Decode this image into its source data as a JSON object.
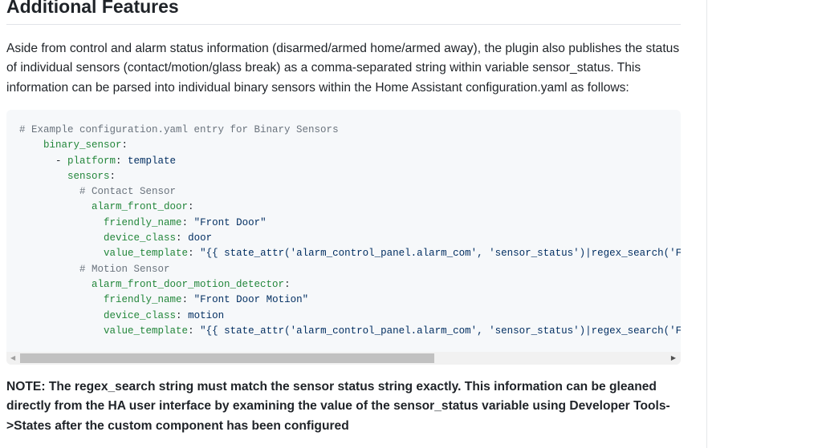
{
  "heading": "Additional Features",
  "intro": "Aside from control and alarm status information (disarmed/armed home/armed away), the plugin also publishes the status of individual sensors (contact/motion/glass break) as a comma-separated string within variable sensor_status. This information can be parsed into individual binary sensors within the Home Assistant configuration.yaml as follows:",
  "code_lines": [
    [
      {
        "t": "# Example configuration.yaml entry for Binary Sensors",
        "c": "c"
      }
    ],
    [
      {
        "t": "    ",
        "c": "p"
      },
      {
        "t": "binary_sensor",
        "c": "k"
      },
      {
        "t": ":",
        "c": "p"
      }
    ],
    [
      {
        "t": "      - ",
        "c": "p"
      },
      {
        "t": "platform",
        "c": "k"
      },
      {
        "t": ": ",
        "c": "p"
      },
      {
        "t": "template",
        "c": "v"
      }
    ],
    [
      {
        "t": "        ",
        "c": "p"
      },
      {
        "t": "sensors",
        "c": "k"
      },
      {
        "t": ":",
        "c": "p"
      }
    ],
    [
      {
        "t": "          # Contact Sensor",
        "c": "c"
      }
    ],
    [
      {
        "t": "            ",
        "c": "p"
      },
      {
        "t": "alarm_front_door",
        "c": "k"
      },
      {
        "t": ":",
        "c": "p"
      }
    ],
    [
      {
        "t": "              ",
        "c": "p"
      },
      {
        "t": "friendly_name",
        "c": "k"
      },
      {
        "t": ": ",
        "c": "p"
      },
      {
        "t": "\"Front Door\"",
        "c": "v"
      }
    ],
    [
      {
        "t": "              ",
        "c": "p"
      },
      {
        "t": "device_class",
        "c": "k"
      },
      {
        "t": ": ",
        "c": "p"
      },
      {
        "t": "door",
        "c": "v"
      }
    ],
    [
      {
        "t": "              ",
        "c": "p"
      },
      {
        "t": "value_template",
        "c": "k"
      },
      {
        "t": ": ",
        "c": "p"
      },
      {
        "t": "\"{{ state_attr('alarm_control_panel.alarm_com', 'sensor_status')|regex_search('Front Door, Open', ignorecase=TRUE) }}\"",
        "c": "v"
      }
    ],
    [
      {
        "t": "          # Motion Sensor",
        "c": "c"
      }
    ],
    [
      {
        "t": "            ",
        "c": "p"
      },
      {
        "t": "alarm_front_door_motion_detector",
        "c": "k"
      },
      {
        "t": ":",
        "c": "p"
      }
    ],
    [
      {
        "t": "              ",
        "c": "p"
      },
      {
        "t": "friendly_name",
        "c": "k"
      },
      {
        "t": ": ",
        "c": "p"
      },
      {
        "t": "\"Front Door Motion\"",
        "c": "v"
      }
    ],
    [
      {
        "t": "              ",
        "c": "p"
      },
      {
        "t": "device_class",
        "c": "k"
      },
      {
        "t": ": ",
        "c": "p"
      },
      {
        "t": "motion",
        "c": "v"
      }
    ],
    [
      {
        "t": "              ",
        "c": "p"
      },
      {
        "t": "value_template",
        "c": "k"
      },
      {
        "t": ": ",
        "c": "p"
      },
      {
        "t": "\"{{ state_attr('alarm_control_panel.alarm_com', 'sensor_status')|regex_search('Front Door Motion, Activated', ignorecase=TRUE) }}\"",
        "c": "v"
      }
    ]
  ],
  "scroll_left": "◀",
  "scroll_right": "▶",
  "note": "NOTE: The regex_search string must match the sensor status string exactly. This information can be gleaned directly from the HA user interface by examining the value of the sensor_status variable using Developer Tools->States after the custom component has been configured"
}
